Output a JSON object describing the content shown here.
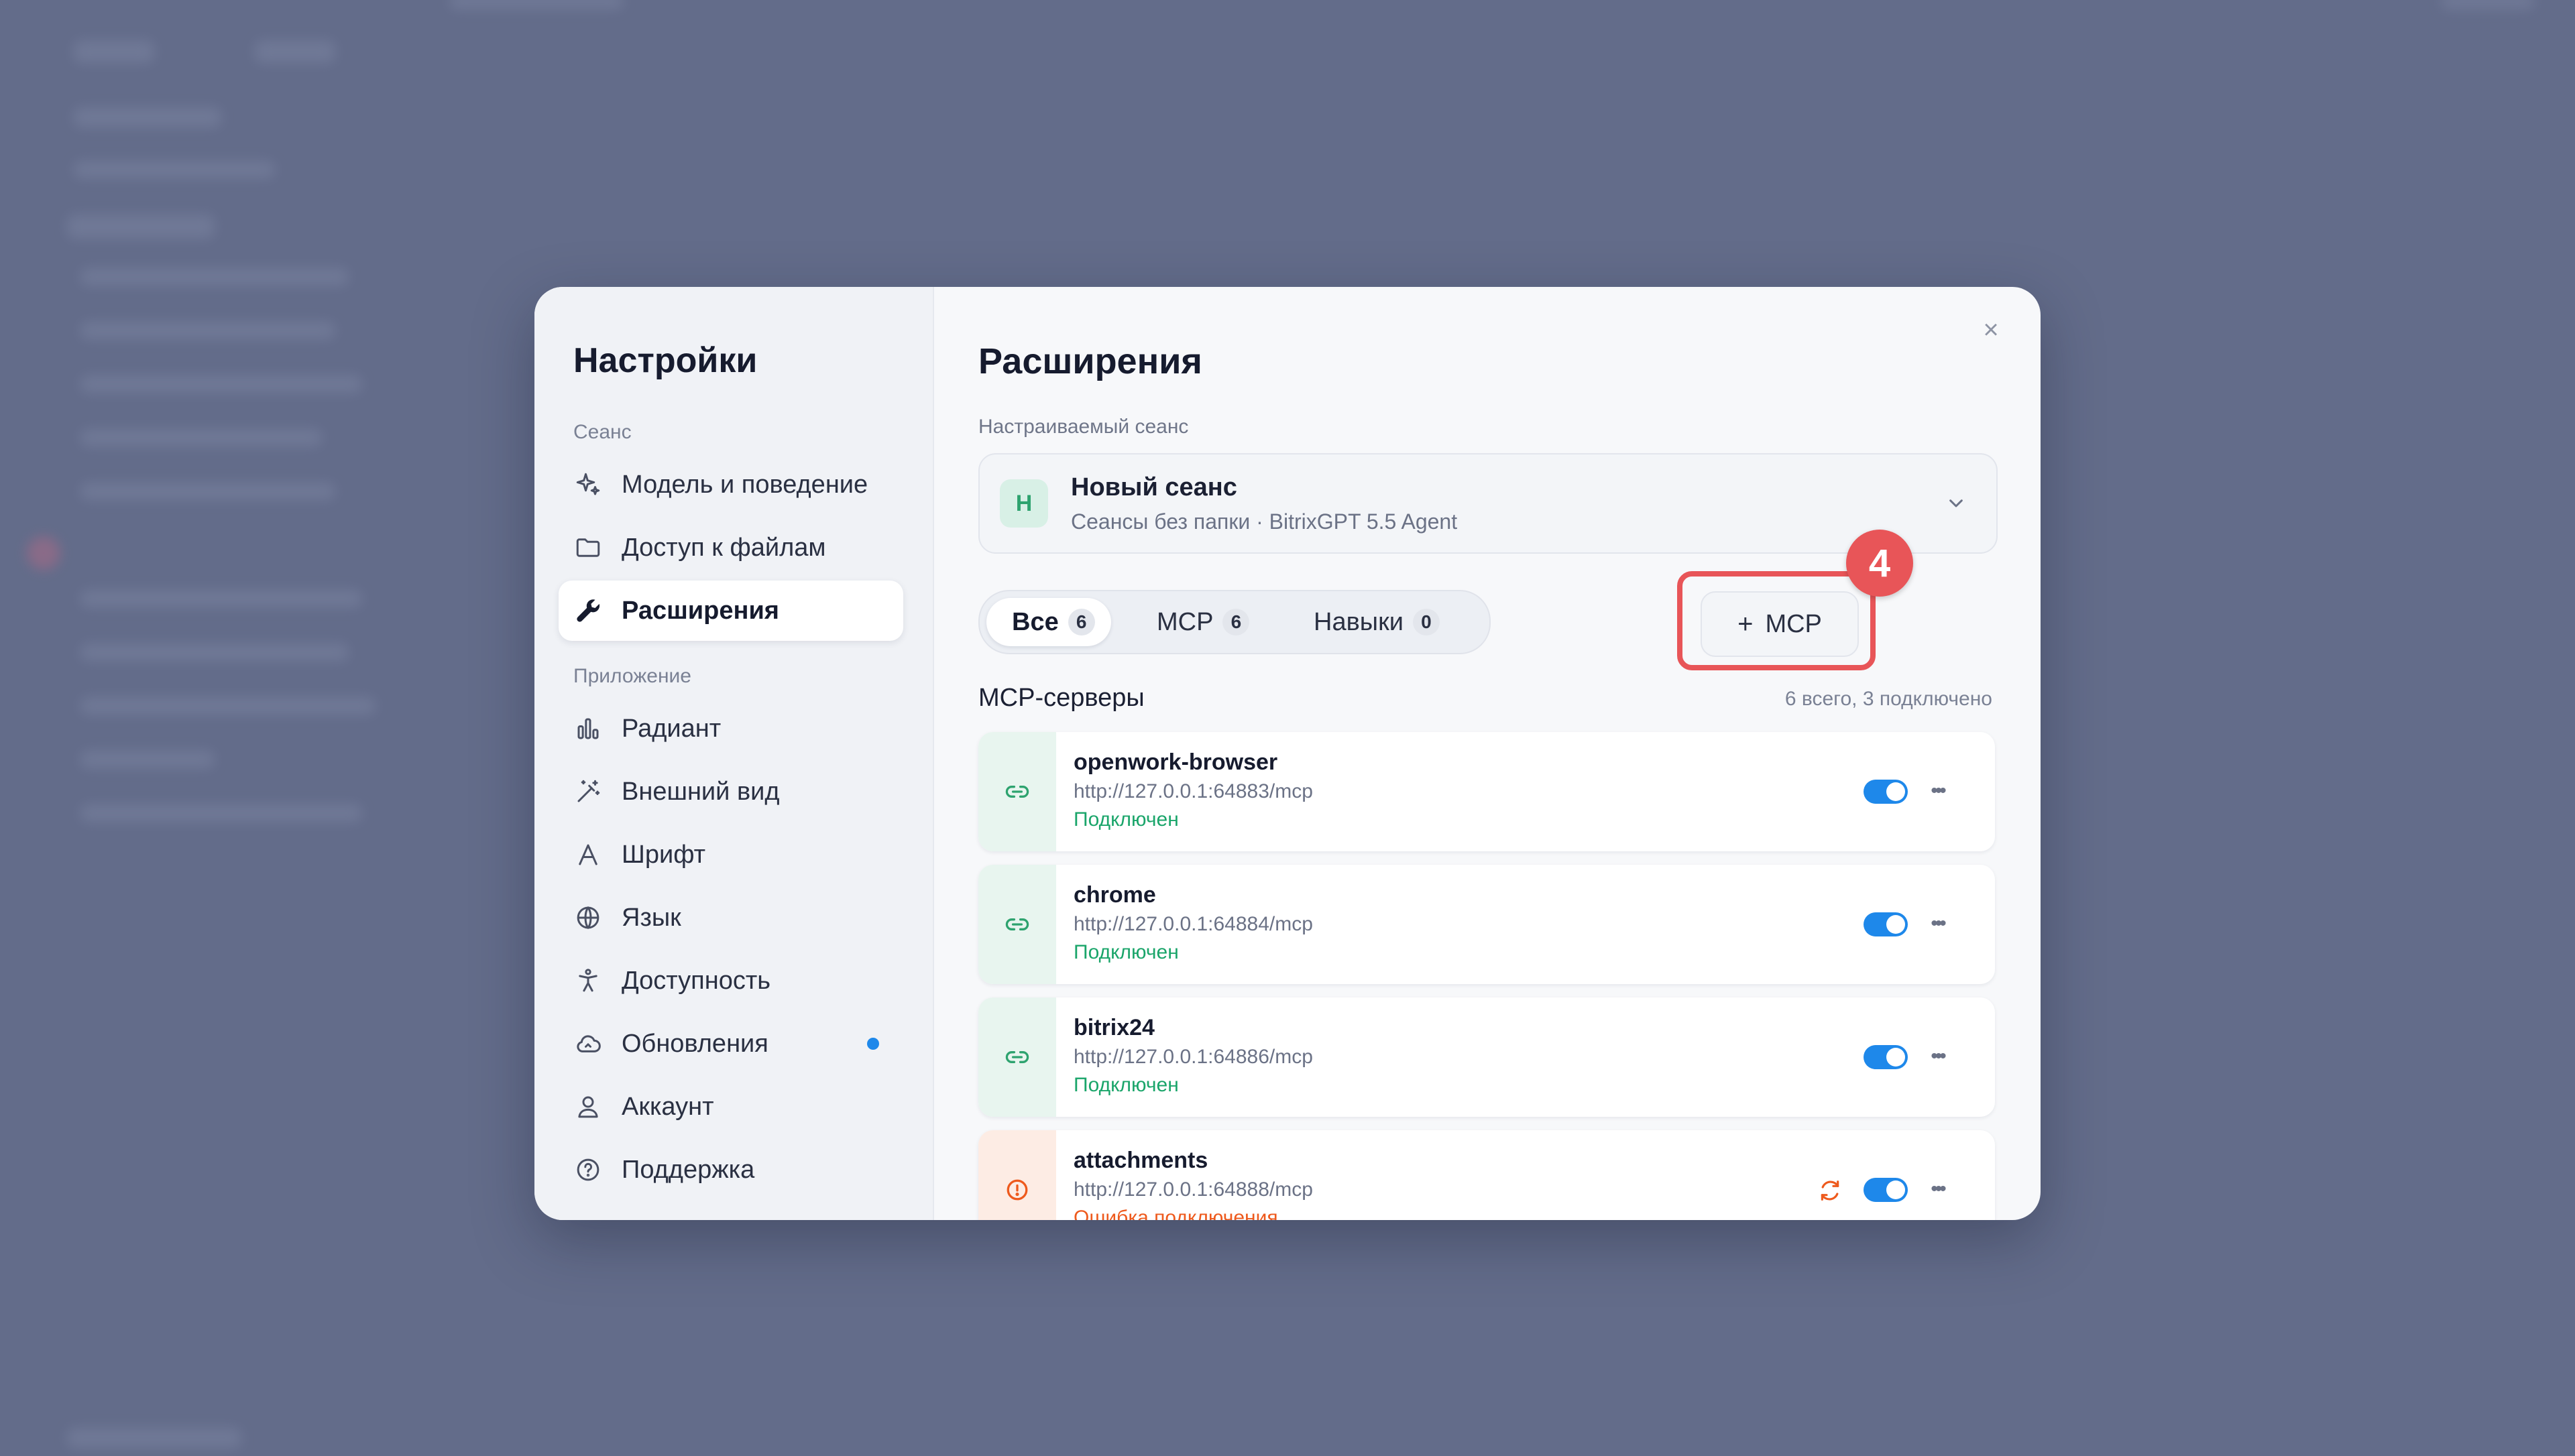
{
  "sidebar": {
    "title": "Настройки",
    "section_session": "Сеанс",
    "section_app": "Приложение",
    "items": [
      {
        "label": "Модель и поведение",
        "icon": "sparkle-icon"
      },
      {
        "label": "Доступ к файлам",
        "icon": "folder-icon"
      },
      {
        "label": "Расширения",
        "icon": "wrench-icon",
        "active": true
      },
      {
        "label": "Радиант",
        "icon": "bar-chart-icon"
      },
      {
        "label": "Внешний вид",
        "icon": "magic-wand-icon"
      },
      {
        "label": "Шрифт",
        "icon": "font-icon"
      },
      {
        "label": "Язык",
        "icon": "globe-icon"
      },
      {
        "label": "Доступность",
        "icon": "accessibility-icon"
      },
      {
        "label": "Обновления",
        "icon": "cloud-icon",
        "badge_dot": true
      },
      {
        "label": "Аккаунт",
        "icon": "user-icon"
      },
      {
        "label": "Поддержка",
        "icon": "help-circle-icon"
      }
    ]
  },
  "main": {
    "title": "Расширения",
    "session_label": "Настраиваемый сеанс",
    "session": {
      "avatar_letter": "Н",
      "name": "Новый сеанс",
      "subtitle": "Сеансы без папки · BitrixGPT 5.5 Agent"
    },
    "tabs": [
      {
        "label": "Все",
        "count": "6",
        "active": true
      },
      {
        "label": "MCP",
        "count": "6"
      },
      {
        "label": "Навыки",
        "count": "0"
      }
    ],
    "add_button": {
      "plus": "+",
      "label": "MCP"
    },
    "highlight_step": "4",
    "list_title": "MCP-серверы",
    "list_meta": "6 всего, 3 подключено",
    "servers": [
      {
        "name": "openwork-browser",
        "url": "http://127.0.0.1:64883/mcp",
        "status": "Подключен",
        "enabled": true
      },
      {
        "name": "chrome",
        "url": "http://127.0.0.1:64884/mcp",
        "status": "Подключен",
        "enabled": true
      },
      {
        "name": "bitrix24",
        "url": "http://127.0.0.1:64886/mcp",
        "status": "Подключен",
        "enabled": true
      },
      {
        "name": "attachments",
        "url": "http://127.0.0.1:64888/mcp",
        "status": "Ошибка подключения",
        "enabled": true,
        "error": true
      }
    ]
  },
  "colors": {
    "accent_blue": "#1e88ea",
    "connected_green": "#1aa56a",
    "error_orange": "#ee5a1d",
    "highlight_red": "#e85558"
  }
}
